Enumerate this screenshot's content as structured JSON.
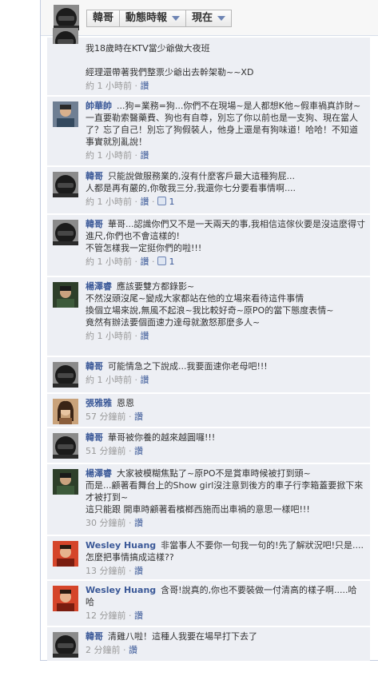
{
  "header": {
    "user_tab": "韓哥",
    "feed_tab": "動態時報",
    "time_tab": "現在"
  },
  "comments": [
    {
      "name": "",
      "text": "我18歲時在KTV當少爺做大夜班\n\n經理還帶著我們整票少爺出去幹架勒~~XD",
      "time": "約 1 小時前",
      "like": "讚",
      "likes": "",
      "avatar": "helmet"
    },
    {
      "name": "帥華帥",
      "text": "...狗=業務=狗...你們不在現場~是人都想K他~假車禍真詐財~一直要勒索醫藥費、狗也有自尊，別忘了你以前也是一支狗、現在當人了？忘了自己！別忘了狗假裝人，他身上還是有狗味道！哈哈！不知道事實就別亂說！",
      "time": "約 1 小時前",
      "like": "讚",
      "likes": "",
      "avatar": "person1"
    },
    {
      "name": "韓哥",
      "text": "只能說做服務業的,沒有什麼客戶最大這種狗屁...\n人都是再有嚴的,你敬我三分,我還你七分要看事情啊....",
      "time": "約 1 小時前",
      "like": "讚",
      "likes": "1",
      "avatar": "helmet"
    },
    {
      "name": "韓哥",
      "text": "華哥...認識你們又不是一天兩天的事,我相信這傢伙要是沒這麼得寸進尺,你們也不會這樣的!\n不管怎樣我一定挺你們的啦!!!",
      "time": "約 1 小時前",
      "like": "讚",
      "likes": "1",
      "avatar": "helmet"
    },
    {
      "name": "楊澤睿",
      "text": "應該要雙方都錄影~\n不然沒頭沒尾~變成大家都站在他的立場來看待這件事情\n換個立場來說,無風不起浪~我比較好奇~原PO的當下態度表情~\n竟然有辦法要個面速力達母就激怒那麼多人~",
      "time": "約 1 小時前",
      "like": "讚",
      "likes": "",
      "avatar": "person2"
    },
    {
      "name": "韓哥",
      "text": "可能情急之下說成...我要面速你老母吧!!!",
      "time": "約 1 小時前",
      "like": "讚",
      "likes": "",
      "avatar": "helmet"
    },
    {
      "name": "張雅雅",
      "text": "恩恩",
      "time": "57 分鐘前",
      "like": "讚",
      "likes": "",
      "avatar": "person3"
    },
    {
      "name": "韓哥",
      "text": "華哥被你養的越來越圓囉!!!",
      "time": "51 分鐘前",
      "like": "讚",
      "likes": "",
      "avatar": "helmet"
    },
    {
      "name": "楊澤睿",
      "text": "大家被模糊焦點了~原PO不是賞車時候被打到頭~\n而是...顧著看舞台上的Show girl沒注意到後方的車子行李箱蓋要掀下來才被打到~\n這只能跟 開車時顧著看檳榔西施而出車禍的意思一樣吧!!!",
      "time": "30 分鐘前",
      "like": "讚",
      "likes": "",
      "avatar": "person2"
    },
    {
      "name": "Wesley Huang",
      "text": "非當事人不要你一句我一句的!先了解狀況吧!只是....怎麼把事情搞成這樣??",
      "time": "13 分鐘前",
      "like": "讚",
      "likes": "",
      "avatar": "person4"
    },
    {
      "name": "Wesley Huang",
      "text": "含哥!說真的,你也不要裝做一付清高的樣子啊.....哈哈",
      "time": "12 分鐘前",
      "like": "讚",
      "likes": "",
      "avatar": "person4"
    },
    {
      "name": "韓哥",
      "text": "清雞八啦！這種人我要在場早打下去了",
      "time": "2 分鐘前",
      "like": "讚",
      "likes": "",
      "avatar": "helmet"
    }
  ]
}
